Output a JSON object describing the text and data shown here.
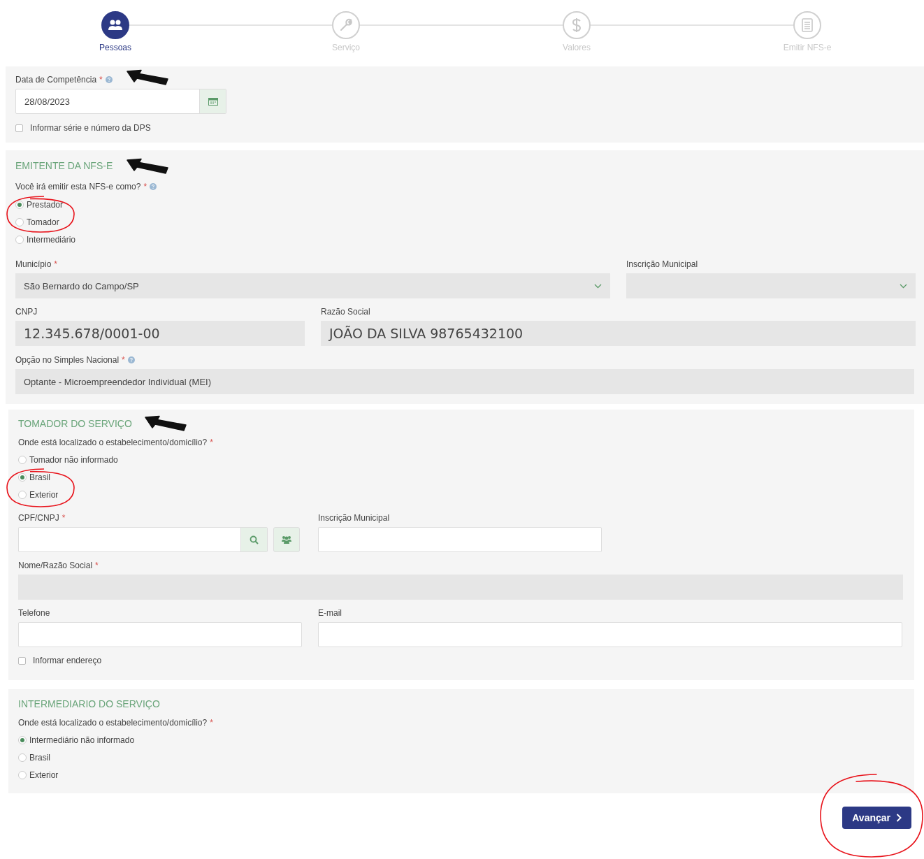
{
  "steps": [
    {
      "label": "Pessoas",
      "selected": true,
      "kind": "people"
    },
    {
      "label": "Serviço",
      "selected": false,
      "kind": "wrench"
    },
    {
      "label": "Valores",
      "selected": false,
      "kind": "dollar"
    },
    {
      "label": "Emitir NFS-e",
      "selected": false,
      "kind": "document"
    }
  ],
  "competencia": {
    "label": "Data de Competência",
    "required": "*",
    "help": true,
    "value": "28/08/2023",
    "checkbox": {
      "label": "Informar série e número da DPS",
      "checked": false
    }
  },
  "emitente": {
    "title": "EMITENTE DA NFS-E",
    "question": {
      "label": "Você irá emitir esta NFS-e como?",
      "required": "*",
      "help": true
    },
    "options": [
      {
        "label": "Prestador",
        "selected": true
      },
      {
        "label": "Tomador",
        "selected": false
      },
      {
        "label": "Intermediário",
        "selected": false
      }
    ],
    "municipio": {
      "label": "Município",
      "required": "*",
      "value": "São Bernardo do Campo/SP"
    },
    "inscricao": {
      "label": "Inscrição Municipal"
    },
    "cnpj": {
      "label": "CNPJ",
      "value": "12.345.678/0001-00"
    },
    "razao": {
      "label": "Razão Social",
      "value": "JOÃO DA SILVA 98765432100"
    },
    "simples": {
      "label": "Opção no Simples Nacional",
      "required": "*",
      "help": true,
      "value": "Optante - Microempreendedor Individual (MEI)"
    }
  },
  "tomador": {
    "title": "TOMADOR DO SERVIÇO",
    "question": {
      "label": "Onde está localizado o estabelecimento/domicílio?",
      "required": "*"
    },
    "options": [
      {
        "label": "Tomador não informado",
        "selected": false
      },
      {
        "label": "Brasil",
        "selected": true
      },
      {
        "label": "Exterior",
        "selected": false
      }
    ],
    "cpf": {
      "label": "CPF/CNPJ",
      "required": "*"
    },
    "inscricao": {
      "label": "Inscrição Municipal"
    },
    "nome": {
      "label": "Nome/Razão Social",
      "required": "*"
    },
    "telefone": {
      "label": "Telefone"
    },
    "email": {
      "label": "E-mail"
    },
    "checkbox": {
      "label": "Informar endereço",
      "checked": false
    }
  },
  "intermediario": {
    "title": "INTERMEDIARIO DO SERVIÇO",
    "question": {
      "label": "Onde está localizado o estabelecimento/domicílio?",
      "required": "*"
    },
    "options": [
      {
        "label": "Intermediário não informado",
        "selected": true
      },
      {
        "label": "Brasil",
        "selected": false
      },
      {
        "label": "Exterior",
        "selected": false
      }
    ]
  },
  "next_button": {
    "label": "Avançar"
  }
}
